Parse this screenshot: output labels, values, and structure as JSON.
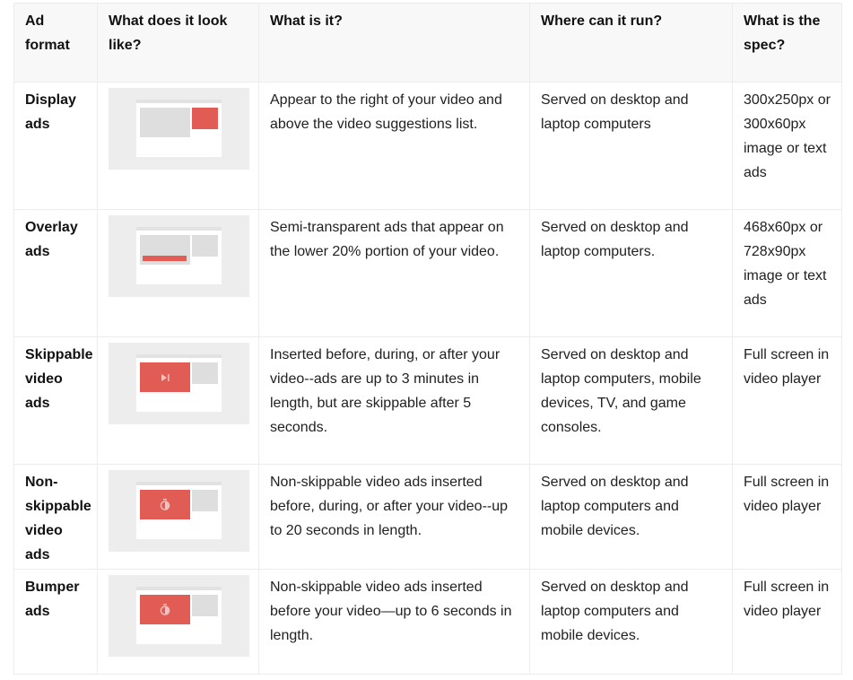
{
  "table": {
    "headers": [
      "Ad format",
      "What does it look like?",
      "What is it?",
      "Where can it run?",
      "What is the spec?"
    ],
    "rows": [
      {
        "format": "Display ads",
        "thumbnail": "display-ad-preview",
        "description": "Appear to the right of your video and above the video suggestions list.",
        "where": "Served on desktop and laptop computers",
        "spec": "300x250px or 300x60px image or text ads"
      },
      {
        "format": "Overlay ads",
        "thumbnail": "overlay-ad-preview",
        "description": "Semi-transparent ads that appear on the lower 20% portion of your video.",
        "where": "Served on desktop and laptop computers.",
        "spec": "468x60px or 728x90px image or text ads"
      },
      {
        "format": "Skippable video ads",
        "thumbnail": "skippable-ad-preview",
        "thumbnail_icon": "skip-next-icon",
        "description": "Inserted before, during, or after your video--ads are up to 3 minutes in length, but are skippable after 5 seconds.",
        "where": "Served on desktop and laptop computers, mobile devices, TV, and game consoles.",
        "spec": "Full screen in video player"
      },
      {
        "format": "Non-skippable video ads",
        "thumbnail": "non-skippable-ad-preview",
        "thumbnail_icon": "stopwatch-icon",
        "description": "Non-skippable video ads inserted before, during, or after your video--up to 20 seconds in length.",
        "where": "Served on desktop and laptop computers and mobile devices.",
        "spec": "Full screen in video player"
      },
      {
        "format": "Bumper ads",
        "thumbnail": "bumper-ad-preview",
        "thumbnail_icon": "stopwatch-icon",
        "description": "Non-skippable video ads inserted before your video—up to 6 seconds in length.",
        "where": "Served on desktop and laptop computers and mobile devices.",
        "spec": "Full screen in video player"
      }
    ]
  },
  "colors": {
    "accent_red": "#e15c55",
    "header_bg": "#f8f8f8",
    "border": "#ececec"
  }
}
